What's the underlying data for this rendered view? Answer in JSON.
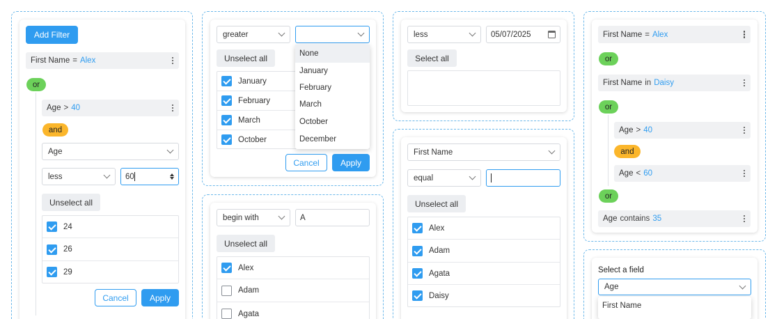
{
  "col1": {
    "add_filter": "Add Filter",
    "chip_first": {
      "field": "First Name",
      "op": "=",
      "value": "Alex"
    },
    "or": "or",
    "chip_age": {
      "field": "Age",
      "op": ">",
      "value": "40"
    },
    "and": "and",
    "field_select": "Age",
    "operator_select": "less",
    "number_value": "60",
    "unselect_all": "Unselect all",
    "items": [
      "24",
      "26",
      "29"
    ],
    "cancel": "Cancel",
    "apply": "Apply"
  },
  "col2a": {
    "operator_select": "greater",
    "unselect_all": "Unselect all",
    "items": [
      "January",
      "February",
      "March",
      "October"
    ],
    "dropdown_options": [
      "None",
      "January",
      "February",
      "March",
      "October",
      "December"
    ],
    "cancel": "Cancel",
    "apply": "Apply"
  },
  "col2b": {
    "operator_select": "begin with",
    "text_value": "A",
    "unselect_all": "Unselect all",
    "items": [
      {
        "label": "Alex",
        "checked": true
      },
      {
        "label": "Adam",
        "checked": false
      },
      {
        "label": "Agata",
        "checked": false
      }
    ]
  },
  "col3a": {
    "operator_select": "less",
    "date_value": "05/07/2025",
    "select_all": "Select all"
  },
  "col3b": {
    "field_select": "First Name",
    "operator_select": "equal",
    "unselect_all": "Unselect all",
    "items": [
      "Alex",
      "Adam",
      "Agata",
      "Daisy"
    ]
  },
  "col4a": {
    "chip_first": {
      "field": "First Name",
      "op": "=",
      "value": "Alex"
    },
    "or1": "or",
    "chip_in": {
      "field": "First Name",
      "op": "in",
      "value": "Daisy"
    },
    "or2": "or",
    "chip_gt": {
      "field": "Age",
      "op": ">",
      "value": "40"
    },
    "and": "and",
    "chip_lt": {
      "field": "Age",
      "op": "<",
      "value": "60"
    },
    "or3": "or",
    "chip_contains": {
      "field": "Age",
      "op": "contains",
      "value": "35"
    }
  },
  "col4b": {
    "label": "Select a field",
    "field_select": "Age",
    "option_first": "First Name"
  },
  "colors": {
    "accent": "#2f9cf0",
    "or": "#6cd15a",
    "and": "#fbb62b",
    "dash": "#6cb8ea"
  }
}
